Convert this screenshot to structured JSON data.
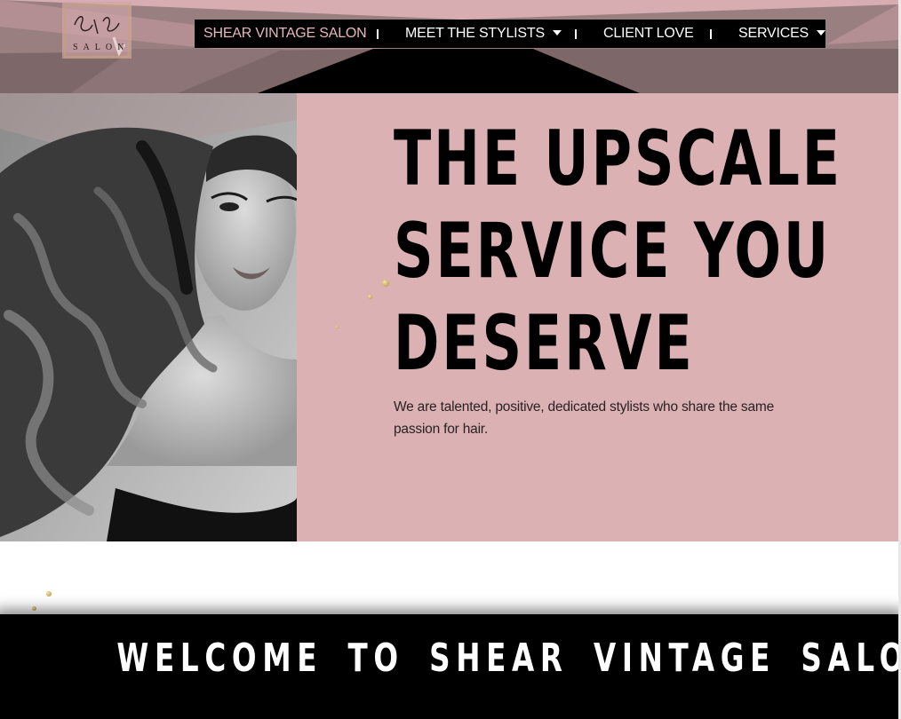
{
  "brand": {
    "logo_icon": "script-logo-icon",
    "logo_script": "Shear Vintage",
    "logo_sub": "SALON"
  },
  "nav": {
    "items": [
      {
        "label": "SHEAR VINTAGE SALON",
        "active": true
      },
      {
        "label": "MEET THE STYLISTS",
        "dropdown": true
      },
      {
        "label": "CLIENT LOVE"
      },
      {
        "label": "SERVICES",
        "dropdown": true
      }
    ]
  },
  "hero": {
    "headline_lines": [
      "THE UPSCALE",
      "SERVICE YOU",
      "DESERVE"
    ],
    "tagline": "We are talented, positive, dedicated stylists who share the same passion for hair.",
    "photo": "black-and-white portrait of woman with long wavy hair"
  },
  "welcome": {
    "title": "WELCOME TO SHEAR VINTAGE SALON"
  },
  "colors": {
    "header": "#9a7f80",
    "hero_bg": "#dbb1b3",
    "nav_bg": "#000000",
    "nav_active": "#e6b7bd",
    "banner_bg": "#000000"
  }
}
